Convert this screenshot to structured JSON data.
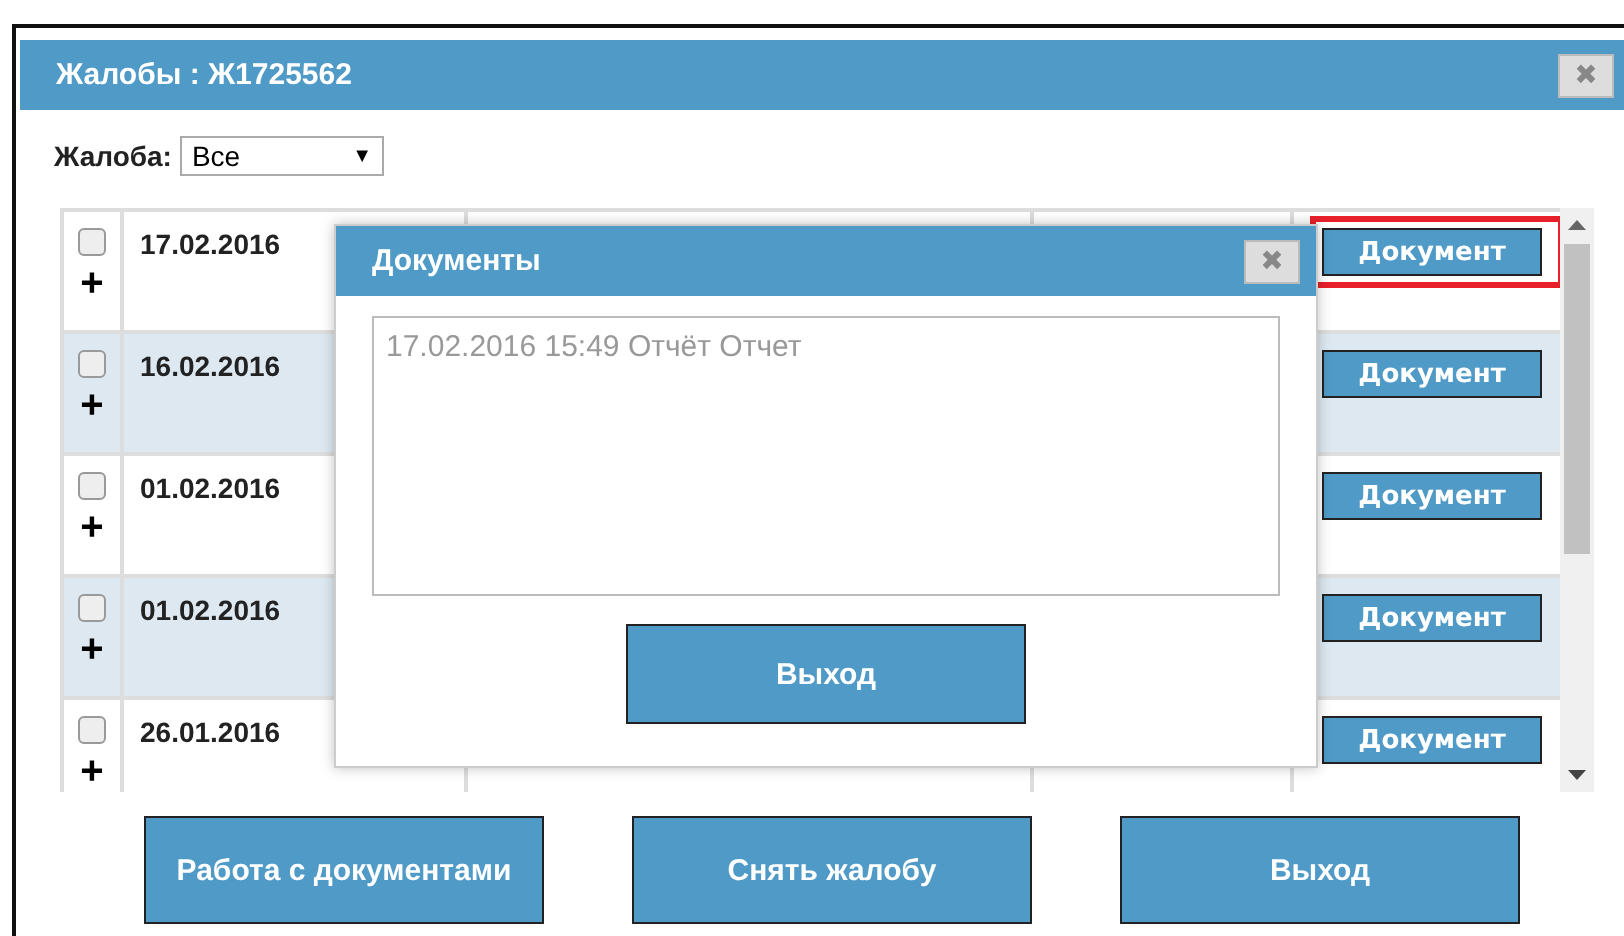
{
  "window": {
    "title": "Жалобы : Ж1725562",
    "close": "✖"
  },
  "filter": {
    "label": "Жалоба:",
    "value": "Все",
    "arrow": "▼"
  },
  "rows": [
    {
      "checked": false,
      "expand": "+",
      "date": "17.02.2016",
      "action": "Документ",
      "highlighted": true
    },
    {
      "checked": false,
      "expand": "+",
      "date": "16.02.2016",
      "action": "Документ",
      "highlighted": false
    },
    {
      "checked": false,
      "expand": "+",
      "date": "01.02.2016",
      "action": "Документ",
      "highlighted": false
    },
    {
      "checked": false,
      "expand": "+",
      "date": "01.02.2016",
      "action": "Документ",
      "highlighted": false
    },
    {
      "checked": false,
      "expand": "+",
      "date": "26.01.2016",
      "action": "Документ",
      "highlighted": false
    }
  ],
  "buttons": [
    "Работа с документами",
    "Снять жалобу",
    "Выход"
  ],
  "dialog": {
    "title": "Документы",
    "close": "✖",
    "items": [
      "17.02.2016 15:49 Отчёт Отчет"
    ],
    "button": "Выход"
  }
}
